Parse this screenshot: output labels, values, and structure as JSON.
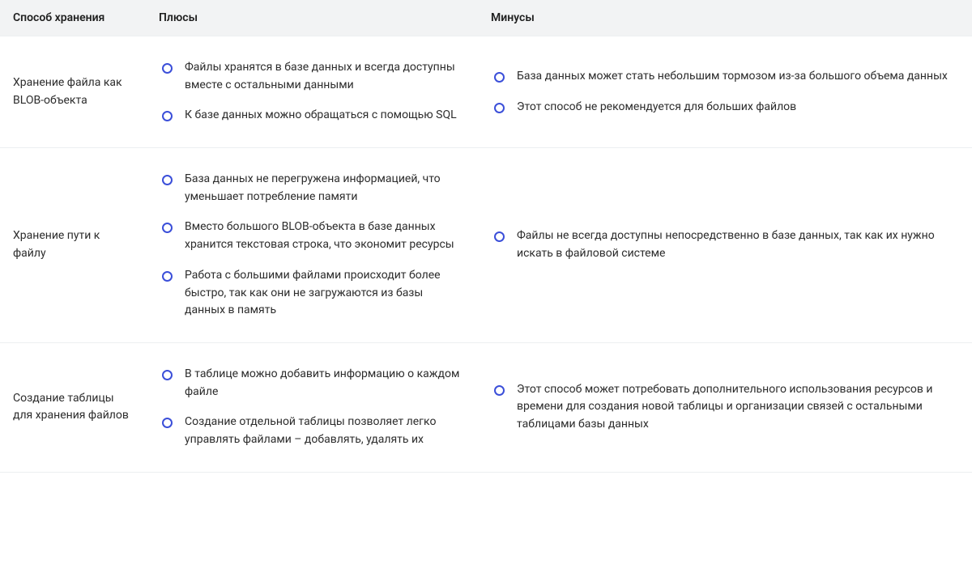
{
  "table": {
    "headers": [
      "Способ хранения",
      "Плюсы",
      "Минусы"
    ],
    "rows": [
      {
        "method": "Хранение файла как BLOB-объекта",
        "pros": [
          "Файлы хранятся в базе данных и всегда доступны вместе с остальными данными",
          "К базе данных можно обращаться с помощью SQL"
        ],
        "cons": [
          "База данных может стать небольшим тормозом из-за большого объема данных",
          "Этот способ не рекомендуется для больших файлов"
        ]
      },
      {
        "method": "Хранение пути к файлу",
        "pros": [
          "База данных не перегружена информацией, что уменьшает потребление памяти",
          "Вместо большого BLOB-объекта в базе данных хранится текстовая строка, что экономит ресурсы",
          "Работа с большими файлами происходит более быстро, так как они не загружаются из базы данных в память"
        ],
        "cons": [
          "Файлы не всегда доступны непосредственно в базе данных, так как их нужно искать в файловой системе"
        ]
      },
      {
        "method": "Создание таблицы для хранения файлов",
        "pros": [
          "В таблице можно добавить информацию о каждом файле",
          "Создание отдельной таблицы позволяет легко управлять файлами – добавлять, удалять их"
        ],
        "cons": [
          "Этот способ может потребовать дополнительного использования ресурсов и времени для создания новой таблицы и организации связей с остальными таблицами базы данных"
        ]
      }
    ]
  }
}
